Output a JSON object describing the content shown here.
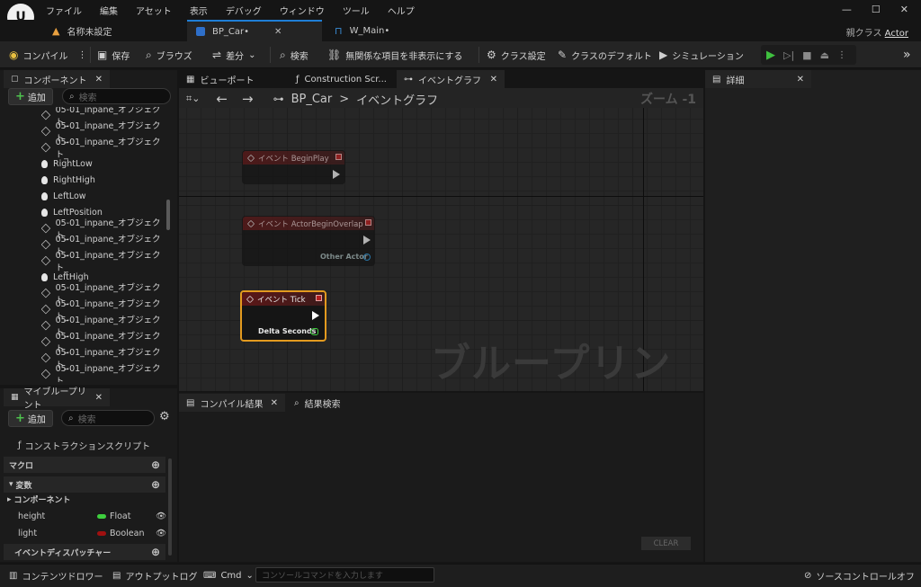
{
  "menu": {
    "items": [
      "ファイル",
      "編集",
      "アセット",
      "表示",
      "デバッグ",
      "ウィンドウ",
      "ツール",
      "ヘルプ"
    ],
    "logo": "U"
  },
  "window_controls": {
    "minimize": "—",
    "maximize": "☐",
    "close": "✕"
  },
  "doc_tabs": [
    {
      "label": "名称未設定"
    },
    {
      "label": "BP_Car•",
      "close": "✕"
    },
    {
      "label": "W_Main•"
    }
  ],
  "parent_class": {
    "label": "親クラス",
    "value": "Actor"
  },
  "toolbar": {
    "compile": "コンパイル",
    "save": "保存",
    "browse": "ブラウズ",
    "diff": "差分",
    "find": "検索",
    "hide_unrelated": "無関係な項目を非表示にする",
    "class_settings": "クラス設定",
    "class_defaults": "クラスのデフォルト",
    "simulation": "シミュレーション"
  },
  "components_panel": {
    "tab": "コンポーネント",
    "add": "追加",
    "search_placeholder": "検索",
    "items": [
      {
        "label": "05-01_inpane_オブジェクト_",
        "icon": "mesh-icon"
      },
      {
        "label": "05-01_inpane_オブジェクト_",
        "icon": "mesh-icon"
      },
      {
        "label": "05-01_inpane_オブジェクト_",
        "icon": "mesh-icon"
      },
      {
        "label": "RightLow",
        "icon": "light-icon"
      },
      {
        "label": "RightHigh",
        "icon": "light-icon"
      },
      {
        "label": "LeftLow",
        "icon": "light-icon"
      },
      {
        "label": "LeftPosition",
        "icon": "light-icon"
      },
      {
        "label": "05-01_inpane_オブジェクト_",
        "icon": "mesh-icon"
      },
      {
        "label": "05-01_inpane_オブジェクト_",
        "icon": "mesh-icon"
      },
      {
        "label": "05-01_inpane_オブジェクト_",
        "icon": "mesh-icon"
      },
      {
        "label": "LeftHigh",
        "icon": "light-icon"
      },
      {
        "label": "05-01_inpane_オブジェクト_",
        "icon": "mesh-icon"
      },
      {
        "label": "05-01_inpane_オブジェクト_",
        "icon": "mesh-icon"
      },
      {
        "label": "05-01_inpane_オブジェクト_",
        "icon": "mesh-icon"
      },
      {
        "label": "05-01_inpane_オブジェクト_",
        "icon": "mesh-icon"
      },
      {
        "label": "05-01_inpane_オブジェクト_",
        "icon": "mesh-icon"
      },
      {
        "label": "05-01_inpane_オブジェクト_",
        "icon": "mesh-icon"
      }
    ]
  },
  "my_blueprint": {
    "tab": "マイブループリント",
    "add": "追加",
    "search_placeholder": "検索",
    "construction_script": "コンストラクションスクリプト",
    "macros": "マクロ",
    "variables": "変数",
    "components": "コンポーネント",
    "vars": [
      {
        "name": "height",
        "type": "Float",
        "color": "#3ecf3e"
      },
      {
        "name": "light",
        "type": "Boolean",
        "color": "#a01010"
      }
    ],
    "event_dispatchers": "イベントディスパッチャー"
  },
  "editor_tabs": [
    {
      "label": "ビューポート"
    },
    {
      "label": "Construction Scr..."
    },
    {
      "label": "イベントグラフ",
      "close": "✕"
    }
  ],
  "graph": {
    "breadcrumb_root": "BP_Car",
    "breadcrumb_sep": ">",
    "breadcrumb_current": "イベントグラフ",
    "zoom": "ズーム -1",
    "watermark": "ブループリント",
    "nodes": [
      {
        "title": "イベント BeginPlay",
        "pins": []
      },
      {
        "title": "イベント ActorBeginOverlap",
        "pins": [
          "Other Actor"
        ]
      },
      {
        "title": "イベント Tick",
        "pins": [
          "Delta Seconds"
        ],
        "selected": true
      }
    ]
  },
  "compiler_results": {
    "tab": "コンパイル結果",
    "find_tab": "結果検索",
    "clear": "CLEAR"
  },
  "details": {
    "tab": "詳細"
  },
  "bottom": {
    "content_drawer": "コンテンツドロワー",
    "output_log": "アウトプットログ",
    "cmd": "Cmd",
    "console_placeholder": "コンソールコマンドを入力します",
    "source_control": "ソースコントロールオフ"
  }
}
